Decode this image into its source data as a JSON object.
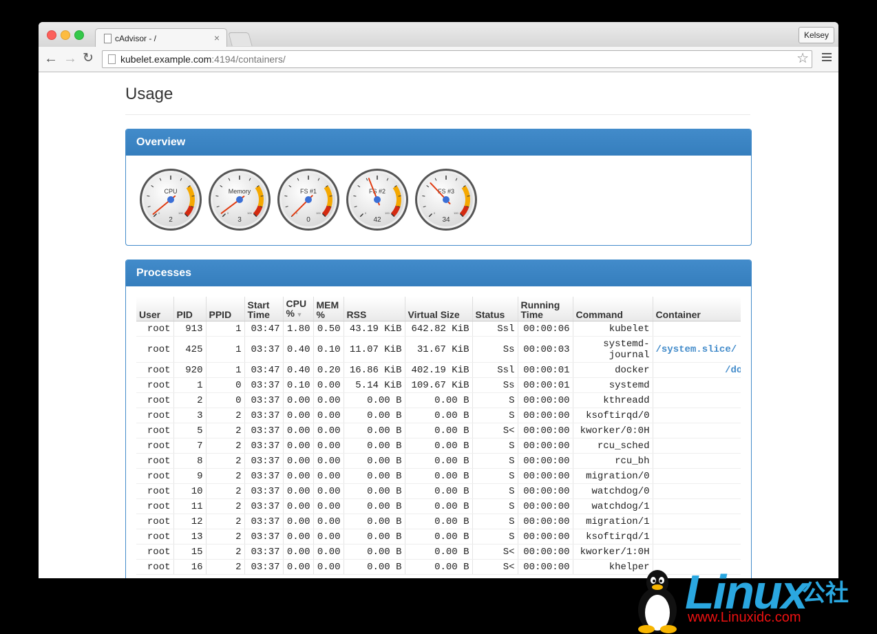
{
  "browser": {
    "tab_title": "cAdvisor - /",
    "tab_close": "×",
    "profile": "Kelsey",
    "url_host": "kubelet.example.com",
    "url_rest": ":4194/containers/",
    "back": "←",
    "forward": "→",
    "reload": "↻",
    "star": "☆"
  },
  "page": {
    "title": "Usage",
    "overview_heading": "Overview",
    "processes_heading": "Processes"
  },
  "gauges": [
    {
      "label": "CPU",
      "value": "2",
      "level": 2
    },
    {
      "label": "Memory",
      "value": "3",
      "level": 3
    },
    {
      "label": "FS #1",
      "value": "0",
      "level": 0
    },
    {
      "label": "FS #2",
      "value": "42",
      "level": 42
    },
    {
      "label": "FS #3",
      "value": "34",
      "level": 34
    }
  ],
  "gauge_scale": {
    "min": "0",
    "max": "100"
  },
  "colors": {
    "panel": "#428bca",
    "link": "#428bca",
    "needle": "#e03a10",
    "hub": "#3b6fd6",
    "warn": "#f5a800",
    "danger": "#d42a10"
  },
  "processes": {
    "headers": [
      "User",
      "PID",
      "PPID",
      "Start Time",
      "CPU %",
      "MEM %",
      "RSS",
      "Virtual Size",
      "Status",
      "Running Time",
      "Command",
      "Container"
    ],
    "sort_indicator": "▼",
    "rows": [
      [
        "root",
        "913",
        "1",
        "03:47",
        "1.80",
        "0.50",
        "43.19 KiB",
        "642.82 KiB",
        "Ssl",
        "00:00:06",
        "kubelet",
        ""
      ],
      [
        "root",
        "425",
        "1",
        "03:37",
        "0.40",
        "0.10",
        "11.07 KiB",
        "31.67 KiB",
        "Ss",
        "00:00:03",
        "systemd-journal",
        "/system.slice/"
      ],
      [
        "root",
        "920",
        "1",
        "03:47",
        "0.40",
        "0.20",
        "16.86 KiB",
        "402.19 KiB",
        "Ssl",
        "00:00:01",
        "docker",
        "/docke"
      ],
      [
        "root",
        "1",
        "0",
        "03:37",
        "0.10",
        "0.00",
        "5.14 KiB",
        "109.67 KiB",
        "Ss",
        "00:00:01",
        "systemd",
        ""
      ],
      [
        "root",
        "2",
        "0",
        "03:37",
        "0.00",
        "0.00",
        "0.00 B",
        "0.00 B",
        "S",
        "00:00:00",
        "kthreadd",
        ""
      ],
      [
        "root",
        "3",
        "2",
        "03:37",
        "0.00",
        "0.00",
        "0.00 B",
        "0.00 B",
        "S",
        "00:00:00",
        "ksoftirqd/0",
        ""
      ],
      [
        "root",
        "5",
        "2",
        "03:37",
        "0.00",
        "0.00",
        "0.00 B",
        "0.00 B",
        "S<",
        "00:00:00",
        "kworker/0:0H",
        ""
      ],
      [
        "root",
        "7",
        "2",
        "03:37",
        "0.00",
        "0.00",
        "0.00 B",
        "0.00 B",
        "S",
        "00:00:00",
        "rcu_sched",
        ""
      ],
      [
        "root",
        "8",
        "2",
        "03:37",
        "0.00",
        "0.00",
        "0.00 B",
        "0.00 B",
        "S",
        "00:00:00",
        "rcu_bh",
        ""
      ],
      [
        "root",
        "9",
        "2",
        "03:37",
        "0.00",
        "0.00",
        "0.00 B",
        "0.00 B",
        "S",
        "00:00:00",
        "migration/0",
        ""
      ],
      [
        "root",
        "10",
        "2",
        "03:37",
        "0.00",
        "0.00",
        "0.00 B",
        "0.00 B",
        "S",
        "00:00:00",
        "watchdog/0",
        ""
      ],
      [
        "root",
        "11",
        "2",
        "03:37",
        "0.00",
        "0.00",
        "0.00 B",
        "0.00 B",
        "S",
        "00:00:00",
        "watchdog/1",
        ""
      ],
      [
        "root",
        "12",
        "2",
        "03:37",
        "0.00",
        "0.00",
        "0.00 B",
        "0.00 B",
        "S",
        "00:00:00",
        "migration/1",
        ""
      ],
      [
        "root",
        "13",
        "2",
        "03:37",
        "0.00",
        "0.00",
        "0.00 B",
        "0.00 B",
        "S",
        "00:00:00",
        "ksoftirqd/1",
        ""
      ],
      [
        "root",
        "15",
        "2",
        "03:37",
        "0.00",
        "0.00",
        "0.00 B",
        "0.00 B",
        "S<",
        "00:00:00",
        "kworker/1:0H",
        ""
      ],
      [
        "root",
        "16",
        "2",
        "03:37",
        "0.00",
        "0.00",
        "0.00 B",
        "0.00 B",
        "S<",
        "00:00:00",
        "khelper",
        ""
      ]
    ]
  },
  "watermark": {
    "word": "Linux",
    "cn": "公社",
    "url": "www.Linuxidc.com"
  }
}
